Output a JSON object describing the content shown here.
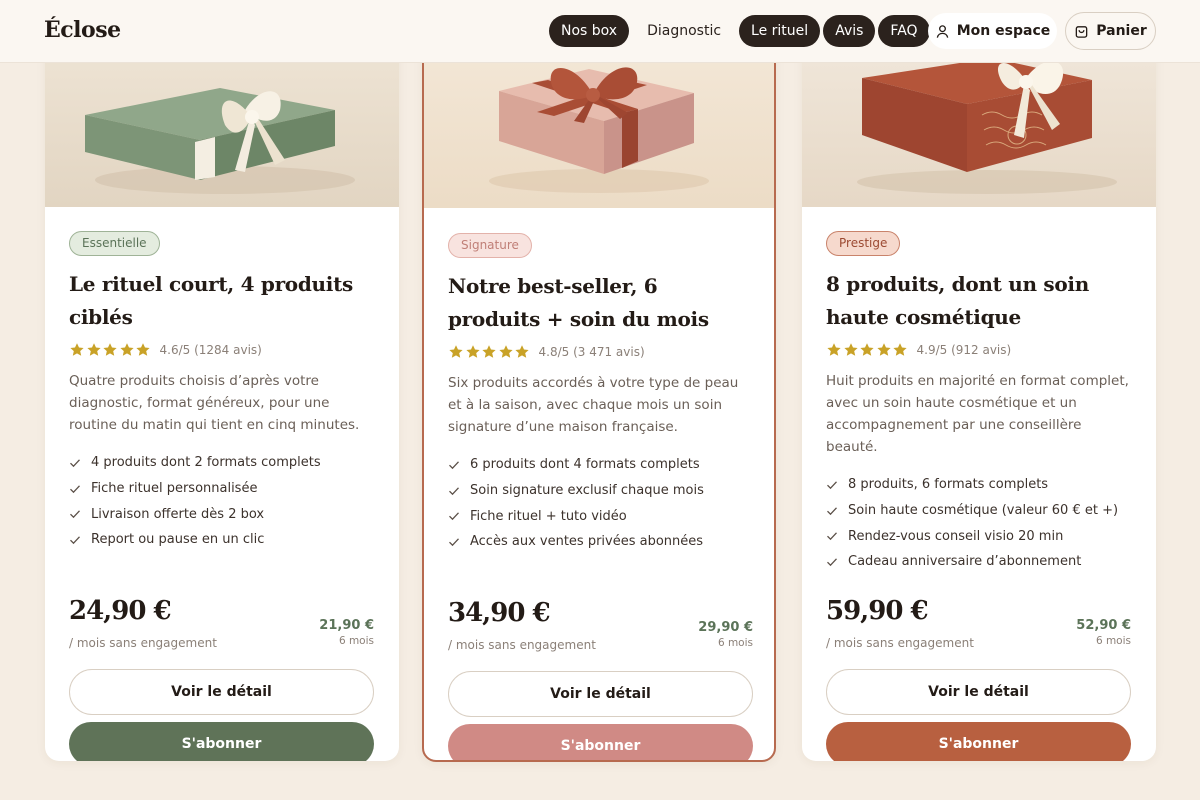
{
  "header": {
    "logo": "Éclose",
    "nav": [
      {
        "label": "Nos box",
        "style": "pill"
      },
      {
        "label": "Diagnostic",
        "style": "plain"
      },
      {
        "label": "Le rituel",
        "style": "pill"
      },
      {
        "label": "Avis",
        "style": "pill"
      },
      {
        "label": "FAQ",
        "style": "pill"
      }
    ],
    "account_label": "Mon espace",
    "account_icon": "user-icon",
    "cart_label": "Panier",
    "cart_icon": "shopping-bag-icon"
  },
  "colors": {
    "background": "#f5ede3",
    "sage": "#5f7358",
    "rose": "#d08a85",
    "terracotta": "#b86040",
    "featured_border": "#b76a4f",
    "star": "#c9a227"
  },
  "cards": [
    {
      "badge": "Essentielle",
      "title": "Le rituel court, 4 produits ciblés",
      "rating": "4.6/5 (1284 avis)",
      "stars": 5,
      "description": "Quatre produits choisis d’après votre diagnostic, format généreux, pour une routine du matin qui tient en cinq minutes.",
      "features": [
        "4 produits dont 2 formats complets",
        "Fiche rituel personnalisée",
        "Livraison offerte dès 2 box",
        "Report ou pause en un clic"
      ],
      "price": "24,90 €",
      "price_sub": "/ mois sans engagement",
      "price_alt": "21,90 €",
      "price_alt_period": "6 mois",
      "detail_label": "Voir le détail",
      "subscribe_label": "S'abonner"
    },
    {
      "badge": "Signature",
      "title": "Notre best-seller, 6 produits + soin du mois",
      "rating": "4.8/5 (3 471 avis)",
      "stars": 5,
      "description": "Six produits accordés à votre type de peau et à la saison, avec chaque mois un soin signature d’une maison française.",
      "features": [
        "6 produits dont 4 formats complets",
        "Soin signature exclusif chaque mois",
        "Fiche rituel + tuto vidéo",
        "Accès aux ventes privées abonnées"
      ],
      "price": "34,90 €",
      "price_sub": "/ mois sans engagement",
      "price_alt": "29,90 €",
      "price_alt_period": "6 mois",
      "detail_label": "Voir le détail",
      "subscribe_label": "S'abonner"
    },
    {
      "badge": "Prestige",
      "title": "8 produits, dont un soin haute cosmétique",
      "rating": "4.9/5 (912 avis)",
      "stars": 5,
      "description": "Huit produits en majorité en format complet, avec un soin haute cosmétique et un accompagnement par une conseillère beauté.",
      "features": [
        "8 produits, 6 formats complets",
        "Soin haute cosmétique (valeur 60 € et +)",
        "Rendez-vous conseil visio 20 min",
        "Cadeau anniversaire d’abonnement"
      ],
      "price": "59,90 €",
      "price_sub": "/ mois sans engagement",
      "price_alt": "52,90 €",
      "price_alt_period": "6 mois",
      "detail_label": "Voir le détail",
      "subscribe_label": "S'abonner"
    }
  ]
}
